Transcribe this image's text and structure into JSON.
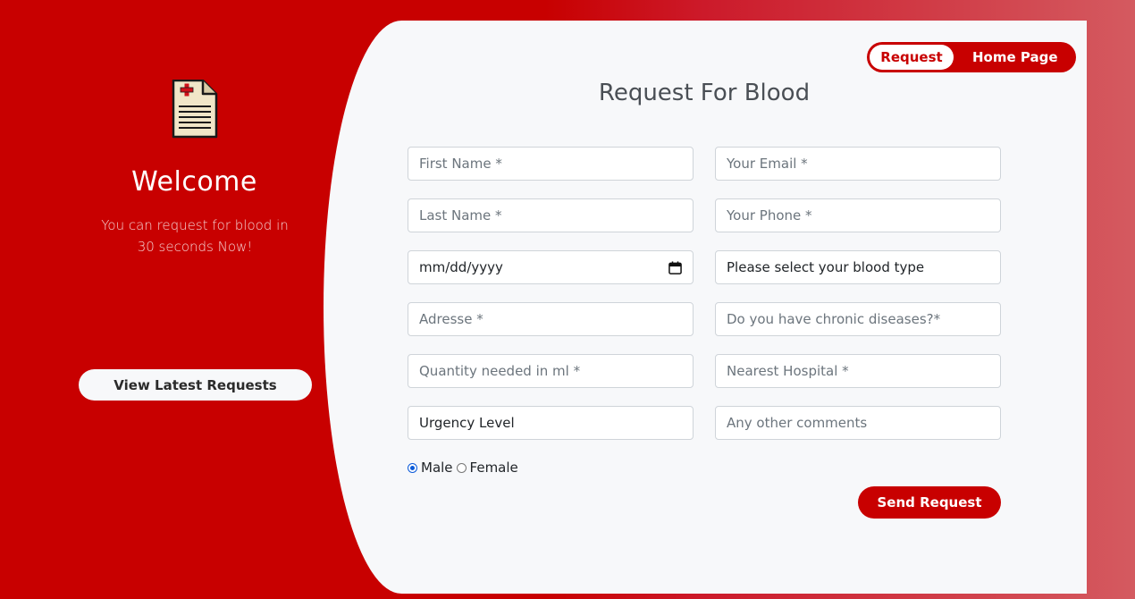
{
  "left": {
    "icon": "medical-document-icon",
    "welcome": "Welcome",
    "subtitle": "You can request for blood in 30 seconds Now!",
    "view_button": "View Latest Requests"
  },
  "nav": {
    "request": "Request",
    "home": "Home Page"
  },
  "form": {
    "title": "Request For Blood",
    "first_name": {
      "placeholder": "First Name *"
    },
    "email": {
      "placeholder": "Your Email *"
    },
    "last_name": {
      "placeholder": "Last Name *"
    },
    "phone": {
      "placeholder": "Your Phone *"
    },
    "date": {
      "value": "mm/dd/yyyy",
      "icon": "calendar-icon"
    },
    "blood_type": {
      "value": "Please select your blood type"
    },
    "address": {
      "placeholder": "Adresse *"
    },
    "chronic": {
      "placeholder": "Do you have chronic diseases?*"
    },
    "quantity": {
      "placeholder": "Quantity needed in ml *"
    },
    "hospital": {
      "placeholder": "Nearest Hospital *"
    },
    "urgency": {
      "value": "Urgency Level"
    },
    "comments": {
      "placeholder": "Any other comments"
    },
    "gender": {
      "male": "Male",
      "female": "Female",
      "selected": "Male"
    },
    "submit": "Send Request"
  },
  "colors": {
    "brand_red": "#c80000",
    "card_bg": "#f7f8fa",
    "title_text": "#4a4f55"
  }
}
